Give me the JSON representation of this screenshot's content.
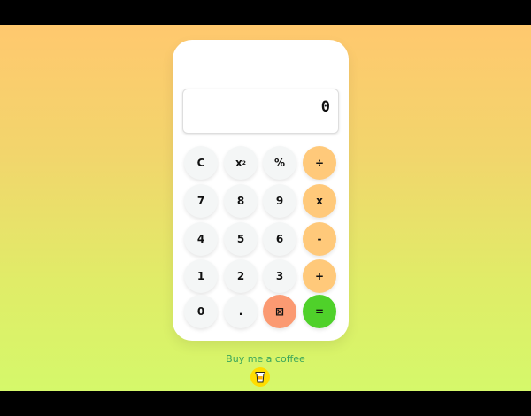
{
  "display": {
    "value": "0"
  },
  "keys": [
    [
      {
        "label": "C",
        "name": "clear-button",
        "kind": ""
      },
      {
        "label": "x",
        "sup": "2",
        "name": "square-button",
        "kind": ""
      },
      {
        "label": "%",
        "name": "percent-button",
        "kind": ""
      },
      {
        "label": "÷",
        "name": "divide-button",
        "kind": "op"
      }
    ],
    [
      {
        "label": "7",
        "name": "digit-7-button",
        "kind": ""
      },
      {
        "label": "8",
        "name": "digit-8-button",
        "kind": ""
      },
      {
        "label": "9",
        "name": "digit-9-button",
        "kind": ""
      },
      {
        "label": "x",
        "name": "multiply-button",
        "kind": "op"
      }
    ],
    [
      {
        "label": "4",
        "name": "digit-4-button",
        "kind": ""
      },
      {
        "label": "5",
        "name": "digit-5-button",
        "kind": ""
      },
      {
        "label": "6",
        "name": "digit-6-button",
        "kind": ""
      },
      {
        "label": "-",
        "name": "subtract-button",
        "kind": "op"
      }
    ],
    [
      {
        "label": "1",
        "name": "digit-1-button",
        "kind": ""
      },
      {
        "label": "2",
        "name": "digit-2-button",
        "kind": ""
      },
      {
        "label": "3",
        "name": "digit-3-button",
        "kind": ""
      },
      {
        "label": "+",
        "name": "add-button",
        "kind": "op"
      }
    ],
    [
      {
        "label": "0",
        "name": "digit-0-button",
        "kind": ""
      },
      {
        "label": ".",
        "name": "decimal-button",
        "kind": ""
      },
      {
        "label": "⊠",
        "name": "backspace-button",
        "kind": "del"
      },
      {
        "label": "=",
        "name": "equals-button",
        "kind": "eq"
      }
    ]
  ],
  "footer": {
    "coffee_label": "Buy me a coffee",
    "coffee_icon": "coffee-cup-icon"
  },
  "colors": {
    "operator": "#ffc97a",
    "delete": "#fb9a72",
    "equals": "#4fd12a",
    "key": "#f4f6f6"
  }
}
